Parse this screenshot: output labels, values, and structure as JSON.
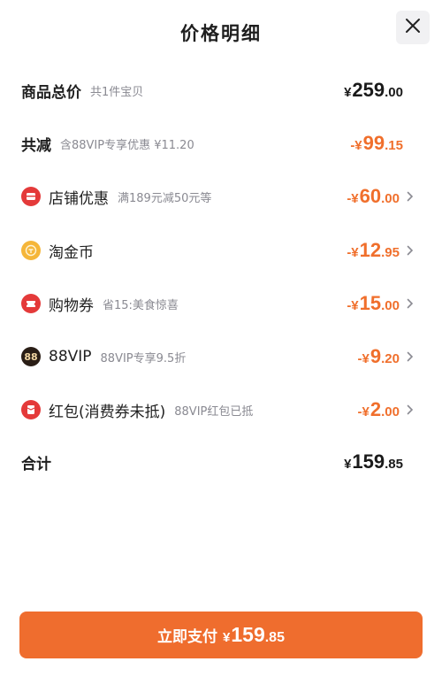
{
  "header": {
    "title": "价格明细",
    "close_icon": "close-icon"
  },
  "rows": [
    {
      "label": "商品总价",
      "sub": "共1件宝贝",
      "currency": "¥",
      "int": "259",
      "dec": ".00"
    },
    {
      "label": "共减",
      "sub": "含88VIP专享优惠 ¥11.20",
      "currency": "-¥",
      "int": "99",
      "dec": ".15"
    },
    {
      "label": "店铺优惠",
      "sub": "满189元减50元等",
      "currency": "-¥",
      "int": "60",
      "dec": ".00",
      "icon": "shop-coupon-icon"
    },
    {
      "label": "淘金币",
      "sub": "",
      "currency": "-¥",
      "int": "12",
      "dec": ".95",
      "icon": "gold-coin-icon"
    },
    {
      "label": "购物券",
      "sub": "省15:美食惊喜",
      "currency": "-¥",
      "int": "15",
      "dec": ".00",
      "icon": "shopping-voucher-icon"
    },
    {
      "label": "88VIP",
      "sub": "88VIP专享9.5折",
      "currency": "-¥",
      "int": "9",
      "dec": ".20",
      "icon": "88vip-badge-icon",
      "badge_text": "88"
    },
    {
      "label": "红包(消费券未抵)",
      "sub": "88VIP红包已抵",
      "currency": "-¥",
      "int": "2",
      "dec": ".00",
      "icon": "red-packet-icon"
    },
    {
      "label": "合计",
      "sub": "",
      "currency": "¥",
      "int": "159",
      "dec": ".85"
    }
  ],
  "pay_button": {
    "label": "立即支付",
    "currency": "¥",
    "int": "159",
    "dec": ".85"
  },
  "colors": {
    "accent": "#ef6d2e",
    "discount": "#f06f2c",
    "icon_red": "#e43a3a",
    "icon_gold": "#f5b63a",
    "icon_dark": "#2a1e16"
  }
}
